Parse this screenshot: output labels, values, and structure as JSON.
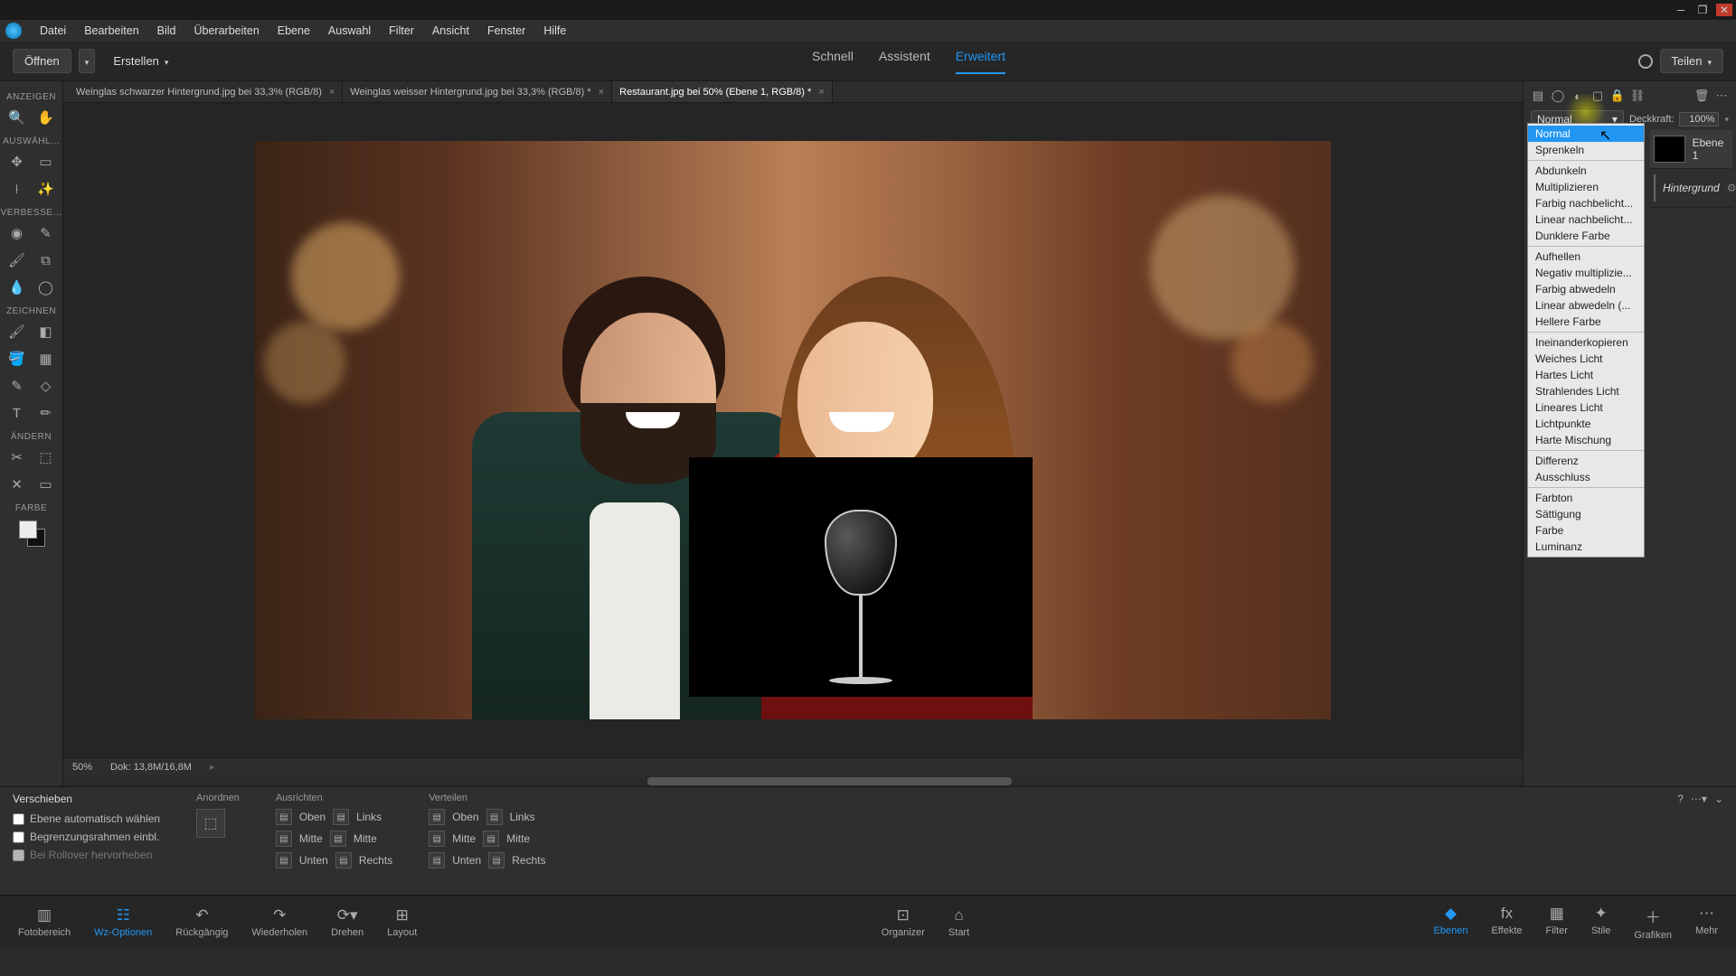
{
  "menu": [
    "Datei",
    "Bearbeiten",
    "Bild",
    "Überarbeiten",
    "Ebene",
    "Auswahl",
    "Filter",
    "Ansicht",
    "Fenster",
    "Hilfe"
  ],
  "topbar": {
    "open": "Öffnen",
    "create": "Erstellen",
    "modes": [
      "Schnell",
      "Assistent",
      "Erweitert"
    ],
    "active_mode": 2,
    "share": "Teilen"
  },
  "tabs": [
    {
      "label": "Weinglas schwarzer Hintergrund.jpg bei 33,3% (RGB/8)"
    },
    {
      "label": "Weinglas weisser Hintergrund.jpg bei 33,3% (RGB/8) *"
    },
    {
      "label": "Restaurant.jpg bei 50% (Ebene 1, RGB/8) *"
    }
  ],
  "active_tab": 2,
  "toolbox": {
    "anzeigen": "ANZEIGEN",
    "auswaehl": "AUSWÄHL...",
    "verbesse": "VERBESSE...",
    "zeichnen": "ZEICHNEN",
    "aendern": "ÄNDERN",
    "farbe": "FARBE"
  },
  "status": {
    "zoom": "50%",
    "doc": "Dok: 13,8M/16,8M"
  },
  "layers_panel": {
    "blend_value": "Normal",
    "opacity_label": "Deckkraft:",
    "opacity_value": "100%",
    "layers": [
      {
        "name": "Ebene 1",
        "bg": false
      },
      {
        "name": "Hintergrund",
        "bg": true
      }
    ]
  },
  "blend_modes": [
    [
      "Normal",
      "Sprenkeln"
    ],
    [
      "Abdunkeln",
      "Multiplizieren",
      "Farbig nachbelicht...",
      "Linear nachbelicht...",
      "Dunklere Farbe"
    ],
    [
      "Aufhellen",
      "Negativ multiplizie...",
      "Farbig abwedeln",
      "Linear abwedeln (...",
      "Hellere Farbe"
    ],
    [
      "Ineinanderkopieren",
      "Weiches Licht",
      "Hartes Licht",
      "Strahlendes Licht",
      "Lineares Licht",
      "Lichtpunkte",
      "Harte Mischung"
    ],
    [
      "Differenz",
      "Ausschluss"
    ],
    [
      "Farbton",
      "Sättigung",
      "Farbe",
      "Luminanz"
    ]
  ],
  "options": {
    "title": "Verschieben",
    "auto": "Ebene automatisch wählen",
    "bounds": "Begrenzungsrahmen einbl.",
    "rollover": "Bei Rollover hervorheben",
    "anordnen": "Anordnen",
    "ausrichten": "Ausrichten",
    "verteilen": "Verteilen",
    "align_rows": {
      "oben": "Oben",
      "mitte": "Mitte",
      "unten": "Unten",
      "links": "Links",
      "mitte2": "Mitte",
      "rechts": "Rechts"
    }
  },
  "bottom": {
    "left": [
      "Fotobereich",
      "Wz-Optionen",
      "Rückgängig",
      "Wiederholen",
      "Drehen",
      "Layout"
    ],
    "center": [
      "Organizer",
      "Start"
    ],
    "right": [
      "Ebenen",
      "Effekte",
      "Filter",
      "Stile",
      "Grafiken",
      "Mehr"
    ],
    "active_right": 0,
    "active_left": 1
  }
}
